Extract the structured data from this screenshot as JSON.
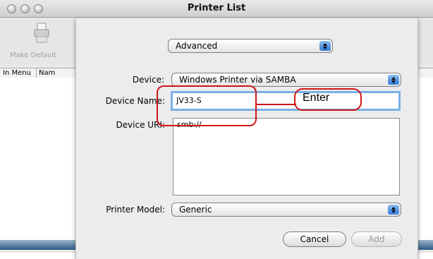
{
  "window": {
    "title": "Printer List"
  },
  "toolbar": {
    "make_default_label": "Make Default",
    "icon": "printer-icon"
  },
  "list": {
    "columns": [
      "In Menu",
      "Nam"
    ]
  },
  "sheet": {
    "mode_popup": "Advanced",
    "device_label": "Device:",
    "device_value": "Windows Printer via SAMBA",
    "device_name_label": "Device Name:",
    "device_name_value": "JV33-S",
    "device_uri_label": "Device URI:",
    "device_uri_value": "smb://",
    "printer_model_label": "Printer Model:",
    "printer_model_value": "Generic",
    "cancel_label": "Cancel",
    "add_label": "Add"
  },
  "annotation": {
    "callout_text": "Enter",
    "color": "#d01515"
  },
  "colors": {
    "focus_ring": "#7bafe6",
    "stepper": "#2f7ad8",
    "dock_bar": "#2c5a86"
  }
}
